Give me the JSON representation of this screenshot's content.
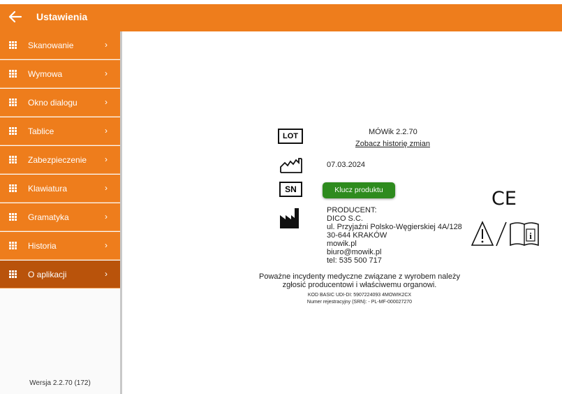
{
  "header": {
    "title": "Ustawienia"
  },
  "sidebar": {
    "items": [
      {
        "label": "Skanowanie"
      },
      {
        "label": "Wymowa"
      },
      {
        "label": "Okno dialogu"
      },
      {
        "label": "Tablice"
      },
      {
        "label": "Zabezpieczenie"
      },
      {
        "label": "Klawiatura"
      },
      {
        "label": "Gramatyka"
      },
      {
        "label": "Historia"
      },
      {
        "label": "O aplikacji",
        "active": true
      }
    ],
    "version": "Wersja 2.2.70 (172)"
  },
  "about": {
    "lot_icon_text": "LOT",
    "sn_icon_text": "SN",
    "app_name": "MÓWik 2.2.70",
    "changelog_link": "Zobacz historię zmian",
    "date": "07.03.2024",
    "product_key_button": "Klucz produktu",
    "producer_lines": [
      "PRODUCENT:",
      "DICO S.C.",
      "ul. Przyjaźni Polsko-Węgierskiej 4A/128",
      "30-644 KRAKÓW",
      "mowik.pl",
      "biuro@mowik.pl",
      "tel: 535 500 717"
    ],
    "ce_mark": "CE",
    "incident_line1": "Poważne incydenty medyczne związane z wyrobem należy",
    "incident_line2": "zgłosić producentowi i właściwemu organowi.",
    "udi": "KOD BASIC UDI-DI: 5907224093 4MOWIK2CX",
    "srn": "Numer rejestracyjny (SRN): - PL-MF-000027270"
  }
}
